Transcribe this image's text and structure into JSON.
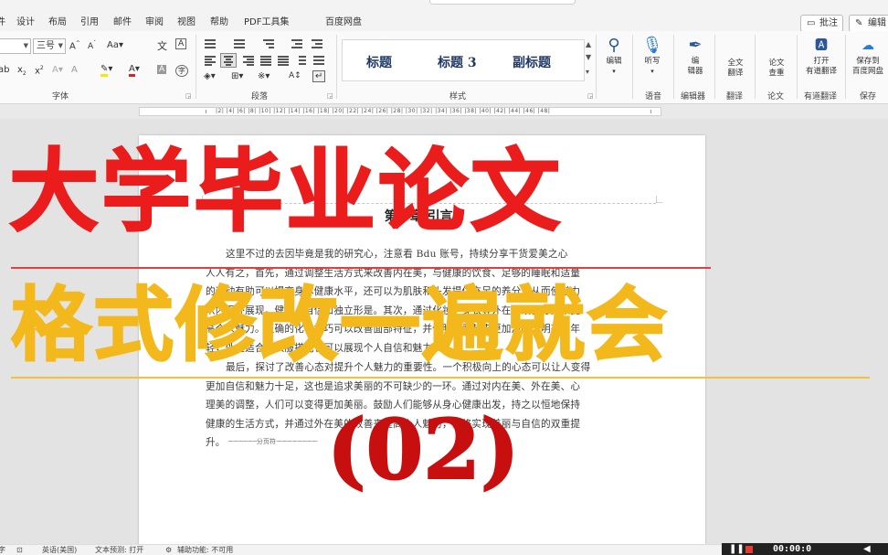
{
  "menu": {
    "items": [
      "件",
      "设计",
      "布局",
      "引用",
      "邮件",
      "审阅",
      "视图",
      "帮助",
      "PDF工具集",
      "百度网盘"
    ],
    "comment_label": "批注",
    "edit_label": "编辑"
  },
  "ribbon": {
    "font_group_label": "字体",
    "paragraph_group_label": "段落",
    "styles_group_label": "样式",
    "font_size": "三号",
    "styles": [
      "标题",
      "标题 3",
      "副标题"
    ],
    "buttons": [
      {
        "label": "编辑",
        "group": ""
      },
      {
        "label": "听写",
        "group": "语音"
      },
      {
        "label": "编\n辑器",
        "group": "编辑器"
      },
      {
        "label": "全文\n翻译",
        "group": "翻译"
      },
      {
        "label": "论文\n查重",
        "group": "论文"
      },
      {
        "label": "打开\n有道翻译",
        "group": "有道翻译"
      },
      {
        "label": "保存到\n百度网盘",
        "group": "保存"
      }
    ]
  },
  "ruler": {
    "numbers": "|2| |4| |6| |8| |10| |12| |14| |16| |18| |20| |22| |24| |26| |28| |30| |32| |34| |36| |38| |40| |42| |44| |46| |48|"
  },
  "document": {
    "heading": "第一章 引言",
    "para1": [
      "这里不过的去因毕竟是我的研究心，注意看 Bdu 账号，持续分享干货爱美之心",
      "人人有之，首先，通过调整生活方式来改善内在美，与健康的饮食、足够的睡眠和适量",
      "的运动有助可以提高身体健康水平，还可以为肌肤和头发提供充足的养分，从而使魅力",
      "从内而外展现。健康、自信和独立形是。其次，通过化妆、穿衣等外在的改善方式来提",
      "高个人魅力。正确的化妆技巧可以改善面部特征，并使脸部看起来更加清晰、明亮和年",
      "轻，外在适合的衣服搭配也可以展现个人自信和魅力。"
    ],
    "para2": [
      "最后，探讨了改善心态对提升个人魅力的重要性。一个积极向上的心态可以让人变得",
      "更加自信和魅力十足，这也是追求美丽的不可缺少的一环。通过对内在美、外在美、心",
      "理美的调整，人们可以变得更加美丽。鼓励人们能够从身心健康出发，持之以恒地保持",
      "健康的生活方式，并通过外在美的改善来提高个人魅力，最终实现美丽与自信的双重提",
      "升。"
    ],
    "page_break_label": "分页符"
  },
  "overlay": {
    "title_main": "大学毕业论文",
    "title_sub": "格式修改一遍就会",
    "episode": "(02)"
  },
  "status": {
    "page": "字",
    "language": "英语(美国)",
    "text_predict": "文本预测: 打开",
    "accessibility": "辅助功能: 不可用"
  },
  "recorder": {
    "timer": "00:00:0"
  },
  "colors": {
    "title_red": "#ea1c1c",
    "title_yellow": "#f2b81c",
    "episode_red": "#c80f0f",
    "style_blue": "#1f3864"
  }
}
